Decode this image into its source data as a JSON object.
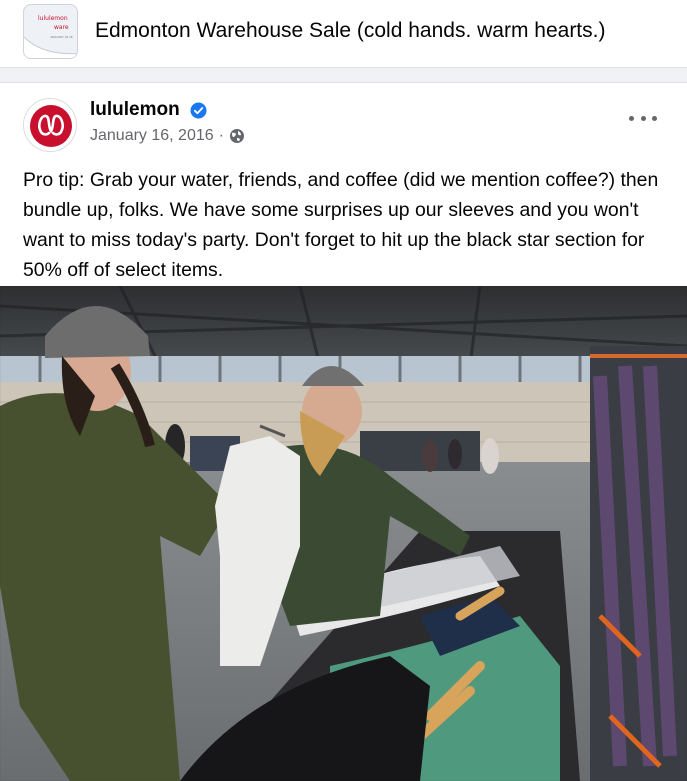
{
  "group": {
    "title": "Edmonton Warehouse Sale (cold hands. warm hearts.)",
    "thumbnail_text": [
      "lululemon",
      "ware",
      "JANUARY 15-18"
    ]
  },
  "post": {
    "author": "lululemon",
    "verified": true,
    "date": "January 16, 2016",
    "separator": "·",
    "audience_icon": "globe-icon",
    "text": "Pro tip: Grab your water, friends, and coffee (did we mention coffee?) then bundle up, folks. We have some surprises up our sleeves and you won't want to miss today's party. Don't forget to hit up the black star section for 50% off of select items.",
    "photo_description_icon": "photo"
  },
  "colors": {
    "brand_red": "#c8102e",
    "verified_blue": "#1877f2",
    "secondary_text": "#65676b"
  }
}
